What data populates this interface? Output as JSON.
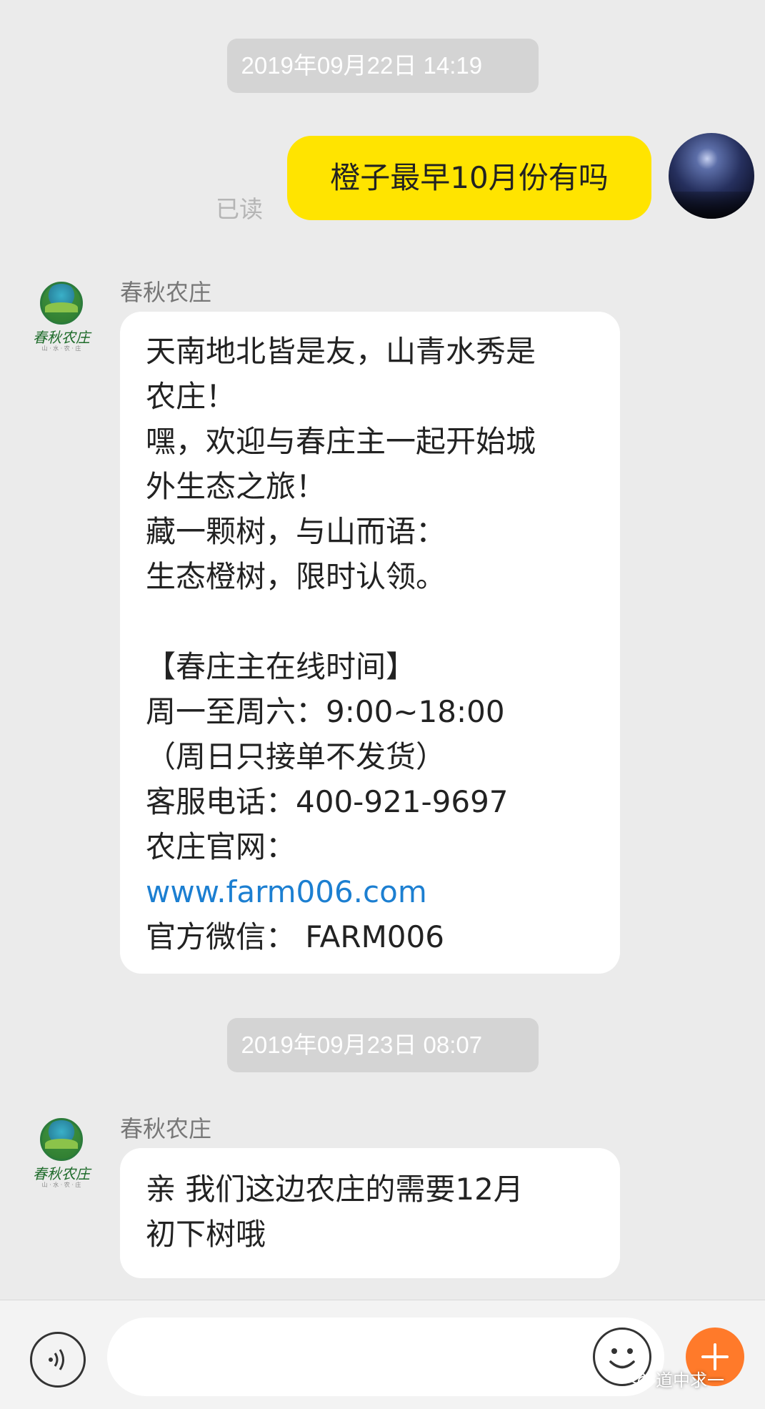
{
  "timestamps": [
    "2019年09月22日 14:19",
    "2019年09月23日 08:07"
  ],
  "outgoing": {
    "read_status": "已读",
    "text": "橙子最早10月份有吗"
  },
  "sender": {
    "name": "春秋农庄",
    "logo_text": "春秋农庄",
    "logo_subtext": "山 · 水 · 农 · 庄"
  },
  "message1": {
    "lines": [
      "天南地北皆是友，山青水秀是",
      "农庄！",
      "嘿，欢迎与春庄主一起开始城",
      "外生态之旅！",
      "藏一颗树，与山而语：",
      "生态橙树，限时认领。",
      "",
      "【春庄主在线时间】",
      "周一至周六：9:00~18:00",
      "（周日只接单不发货）",
      "客服电话：400-921-9697",
      "农庄官网：",
      "www.farm006.com",
      "官方微信： FARM006"
    ]
  },
  "message2": {
    "lines": [
      "亲 我们这边农庄的需要12月",
      "初下树哦"
    ]
  },
  "input_bar": {
    "placeholder": "",
    "watermark": "道中求一"
  },
  "colors": {
    "background": "#ebebeb",
    "outgoing_bubble": "#ffe400",
    "incoming_bubble": "#ffffff",
    "link": "#1c7fd1",
    "plus_button": "#ff7a2a"
  },
  "icons": [
    "self-avatar",
    "farm-logo-avatar",
    "voice-icon",
    "emoji-icon",
    "plus-icon",
    "wechat-icon"
  ]
}
